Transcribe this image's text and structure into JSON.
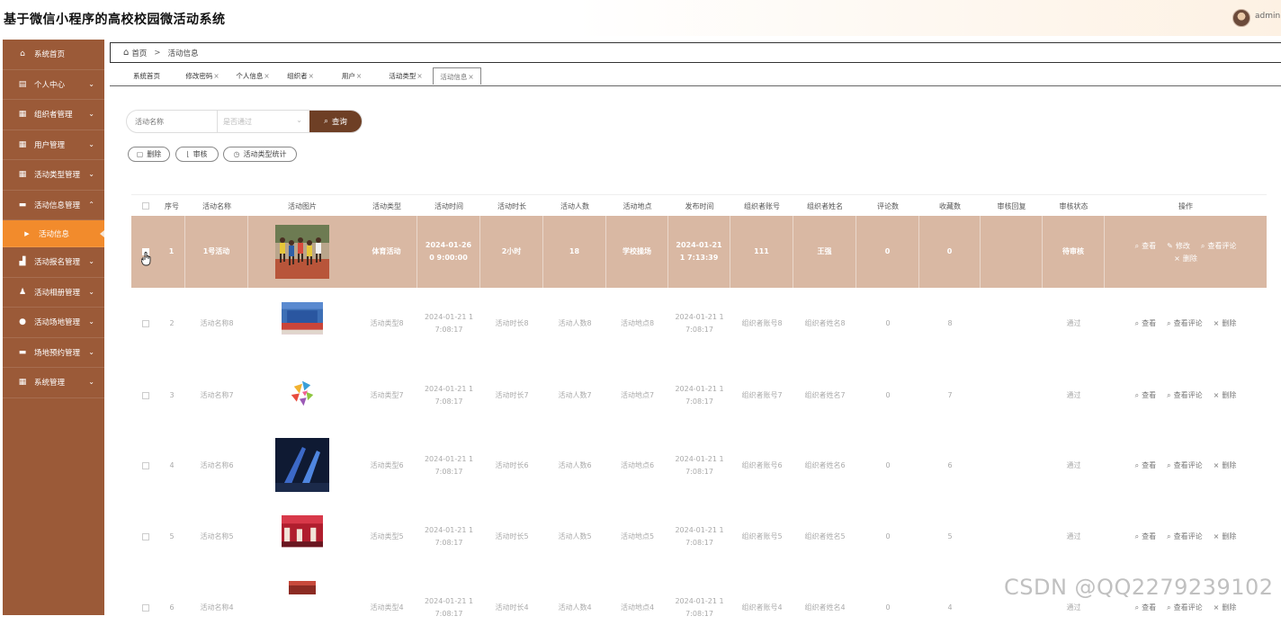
{
  "app": {
    "title": "基于微信小程序的高校校园微活动系统",
    "user": "admin"
  },
  "sidebar": {
    "items": [
      {
        "label": "系统首页",
        "icon": "home-icon",
        "glyph": "⌂",
        "chev": ""
      },
      {
        "label": "个人中心",
        "icon": "card-icon",
        "glyph": "▤",
        "chev": "⌄"
      },
      {
        "label": "组织者管理",
        "icon": "grid-icon",
        "glyph": "▦",
        "chev": "⌄"
      },
      {
        "label": "用户管理",
        "icon": "grid-icon",
        "glyph": "▦",
        "chev": "⌄"
      },
      {
        "label": "活动类型管理",
        "icon": "grid-icon",
        "glyph": "▦",
        "chev": "⌄"
      },
      {
        "label": "活动信息管理",
        "icon": "comment-icon",
        "glyph": "▬",
        "chev": "⌃"
      },
      {
        "label": "活动信息",
        "icon": "triangle-right-icon",
        "glyph": "▶",
        "chev": "",
        "sub": true
      },
      {
        "label": "活动报名管理",
        "icon": "bag-icon",
        "glyph": "▟",
        "chev": "⌄"
      },
      {
        "label": "活动相册管理",
        "icon": "person-icon",
        "glyph": "♟",
        "chev": "⌄"
      },
      {
        "label": "活动场地管理",
        "icon": "pin-icon",
        "glyph": "●",
        "chev": "⌄"
      },
      {
        "label": "场地预约管理",
        "icon": "message-icon",
        "glyph": "▬",
        "chev": "⌄"
      },
      {
        "label": "系统管理",
        "icon": "grid-icon",
        "glyph": "▦",
        "chev": "⌄"
      }
    ]
  },
  "breadcrumb": {
    "home": "首页",
    "current": "活动信息"
  },
  "tabs": [
    {
      "label": "系统首页",
      "close": ""
    },
    {
      "label": "修改密码",
      "close": "×"
    },
    {
      "label": "个人信息",
      "close": "×"
    },
    {
      "label": "组织者",
      "close": "×"
    },
    {
      "label": "用户",
      "close": "×"
    },
    {
      "label": "活动类型",
      "close": "×"
    },
    {
      "label": "活动信息",
      "close": "×",
      "active": true
    }
  ],
  "search": {
    "name_placeholder": "活动名称",
    "status_placeholder": "是否通过",
    "button": "查询"
  },
  "actions": {
    "delete": "删除",
    "audit": "审核",
    "stats": "活动类型统计"
  },
  "table": {
    "headers": [
      "序号",
      "活动名称",
      "活动图片",
      "活动类型",
      "活动时间",
      "活动时长",
      "活动人数",
      "活动地点",
      "发布时间",
      "组织者账号",
      "组织者姓名",
      "评论数",
      "收藏数",
      "审核回复",
      "审核状态",
      "操作"
    ],
    "rows": [
      {
        "no": "1",
        "name": "1号活动",
        "img": "track",
        "type": "体育活动",
        "time": "2024-01-26 0 9:00:00",
        "duration": "2小时",
        "people": "18",
        "place": "学校操场",
        "pubtime": "2024-01-21 1 7:13:39",
        "account": "111",
        "orgname": "王强",
        "comments": "0",
        "favs": "0",
        "reply": "",
        "status": "待审核",
        "ops": [
          "查看",
          "修改",
          "查看评论",
          "删除"
        ]
      },
      {
        "no": "2",
        "name": "活动名称8",
        "img": "stage",
        "type": "活动类型8",
        "time": "2024-01-21 1 7:08:17",
        "duration": "活动时长8",
        "people": "活动人数8",
        "place": "活动地点8",
        "pubtime": "2024-01-21 1 7:08:17",
        "account": "组织者账号8",
        "orgname": "组织者姓名8",
        "comments": "0",
        "favs": "8",
        "reply": "",
        "status": "通过",
        "ops": [
          "查看",
          "查看评论",
          "删除"
        ]
      },
      {
        "no": "3",
        "name": "活动名称7",
        "img": "logo",
        "type": "活动类型7",
        "time": "2024-01-21 1 7:08:17",
        "duration": "活动时长7",
        "people": "活动人数7",
        "place": "活动地点7",
        "pubtime": "2024-01-21 1 7:08:17",
        "account": "组织者账号7",
        "orgname": "组织者姓名7",
        "comments": "0",
        "favs": "7",
        "reply": "",
        "status": "通过",
        "ops": [
          "查看",
          "查看评论",
          "删除"
        ]
      },
      {
        "no": "4",
        "name": "活动名称6",
        "img": "dark",
        "type": "活动类型6",
        "time": "2024-01-21 1 7:08:17",
        "duration": "活动时长6",
        "people": "活动人数6",
        "place": "活动地点6",
        "pubtime": "2024-01-21 1 7:08:17",
        "account": "组织者账号6",
        "orgname": "组织者姓名6",
        "comments": "0",
        "favs": "6",
        "reply": "",
        "status": "通过",
        "ops": [
          "查看",
          "查看评论",
          "删除"
        ]
      },
      {
        "no": "5",
        "name": "活动名称5",
        "img": "red",
        "type": "活动类型5",
        "time": "2024-01-21 1 7:08:17",
        "duration": "活动时长5",
        "people": "活动人数5",
        "place": "活动地点5",
        "pubtime": "2024-01-21 1 7:08:17",
        "account": "组织者账号5",
        "orgname": "组织者姓名5",
        "comments": "0",
        "favs": "5",
        "reply": "",
        "status": "通过",
        "ops": [
          "查看",
          "查看评论",
          "删除"
        ]
      },
      {
        "no": "6",
        "name": "活动名称4",
        "img": "red2",
        "type": "活动类型4",
        "time": "2024-01-21 1 7:08:17",
        "duration": "活动时长4",
        "people": "活动人数4",
        "place": "活动地点4",
        "pubtime": "2024-01-21 1 7:08:17",
        "account": "组织者账号4",
        "orgname": "组织者姓名4",
        "comments": "0",
        "favs": "4",
        "reply": "",
        "status": "通过",
        "ops": [
          "查看",
          "查看评论",
          "删除"
        ]
      }
    ]
  },
  "watermark": "CSDN @QQ2279239102",
  "colors": {
    "sidebar": "#9b5a38",
    "active_sub": "#f28b2c",
    "highlight_row": "#d9b8a3",
    "search_btn": "#6e3f25"
  }
}
